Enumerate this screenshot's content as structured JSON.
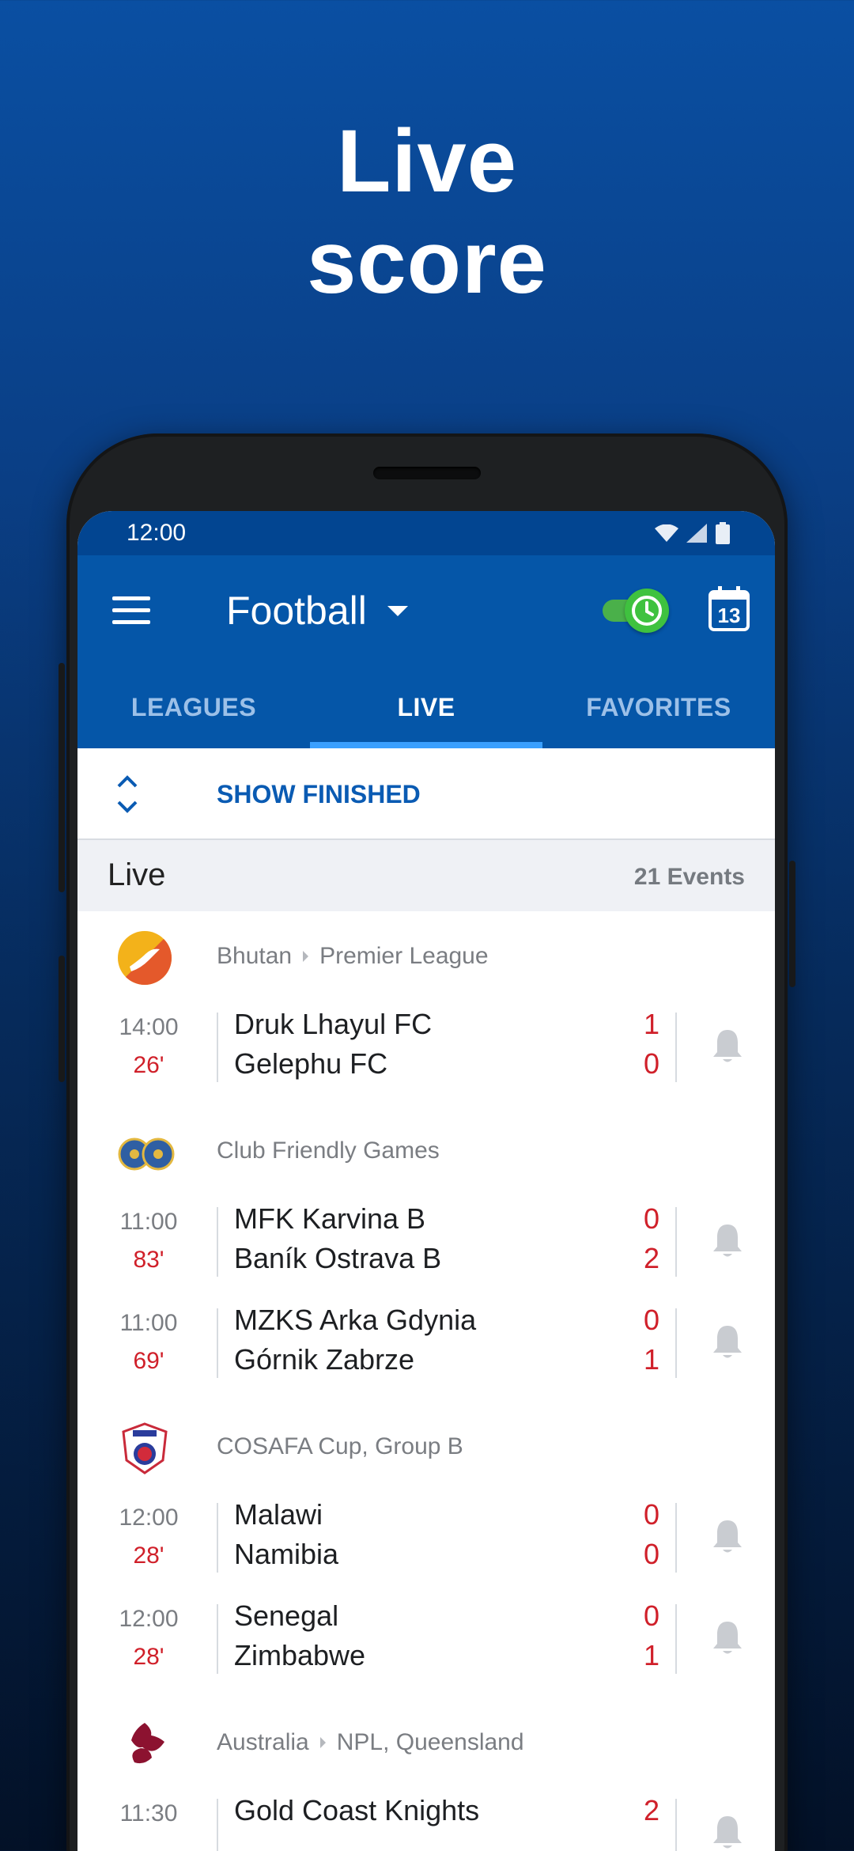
{
  "headline": {
    "line1": "Live",
    "line2": "score"
  },
  "status_bar": {
    "time": "12:00"
  },
  "app_bar": {
    "sport": "Football",
    "calendar_day": "13"
  },
  "tabs": [
    {
      "label": "LEAGUES",
      "active": false
    },
    {
      "label": "LIVE",
      "active": true
    },
    {
      "label": "FAVORITES",
      "active": false
    }
  ],
  "show_finished_label": "SHOW FINISHED",
  "section": {
    "title": "Live",
    "count": "21 Events"
  },
  "leagues": [
    {
      "icon": "bhutan-flag-icon",
      "country": "Bhutan",
      "name": "Premier League",
      "matches": [
        {
          "time": "14:00",
          "minute": "26'",
          "home": "Druk Lhayul FC",
          "away": "Gelephu FC",
          "home_score": "1",
          "away_score": "0"
        }
      ]
    },
    {
      "icon": "club-friendly-games-icon",
      "country": "",
      "name": "Club Friendly Games",
      "matches": [
        {
          "time": "11:00",
          "minute": "83'",
          "home": "MFK Karvina B",
          "away": "Baník Ostrava B",
          "home_score": "0",
          "away_score": "2"
        },
        {
          "time": "11:00",
          "minute": "69'",
          "home": "MZKS Arka Gdynia",
          "away": "Górnik Zabrze",
          "home_score": "0",
          "away_score": "1"
        }
      ]
    },
    {
      "icon": "cosafa-cup-icon",
      "country": "",
      "name": "COSAFA Cup, Group B",
      "matches": [
        {
          "time": "12:00",
          "minute": "28'",
          "home": "Malawi",
          "away": "Namibia",
          "home_score": "0",
          "away_score": "0"
        },
        {
          "time": "12:00",
          "minute": "28'",
          "home": "Senegal",
          "away": "Zimbabwe",
          "home_score": "0",
          "away_score": "1"
        }
      ]
    },
    {
      "icon": "australia-npl-icon",
      "country": "Australia",
      "name": "NPL, Queensland",
      "matches": [
        {
          "time": "11:30",
          "minute": "",
          "home": "Gold Coast Knights",
          "away": "",
          "home_score": "2",
          "away_score": ""
        }
      ]
    }
  ],
  "colors": {
    "primary": "#0556a8",
    "status_bar": "#024591",
    "live_red": "#d0202a",
    "toggle_green": "#3fc23f"
  }
}
